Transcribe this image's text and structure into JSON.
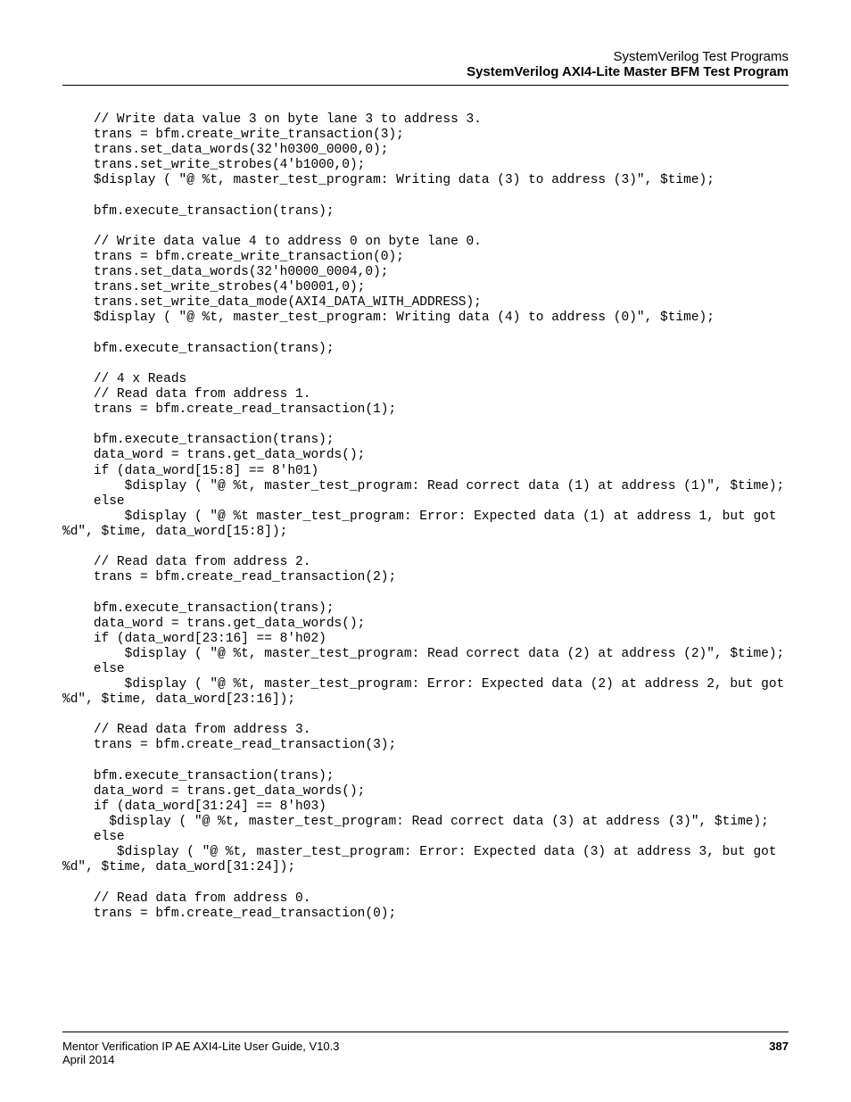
{
  "header": {
    "line1": "SystemVerilog Test Programs",
    "line2": "SystemVerilog AXI4-Lite Master BFM Test Program"
  },
  "code": "    // Write data value 3 on byte lane 3 to address 3.\n    trans = bfm.create_write_transaction(3);\n    trans.set_data_words(32'h0300_0000,0);\n    trans.set_write_strobes(4'b1000,0);\n    $display ( \"@ %t, master_test_program: Writing data (3) to address (3)\", $time);\n\n    bfm.execute_transaction(trans);\n\n    // Write data value 4 to address 0 on byte lane 0.\n    trans = bfm.create_write_transaction(0);\n    trans.set_data_words(32'h0000_0004,0);\n    trans.set_write_strobes(4'b0001,0);\n    trans.set_write_data_mode(AXI4_DATA_WITH_ADDRESS);\n    $display ( \"@ %t, master_test_program: Writing data (4) to address (0)\", $time);\n\n    bfm.execute_transaction(trans);\n\n    // 4 x Reads\n    // Read data from address 1.\n    trans = bfm.create_read_transaction(1);\n\n    bfm.execute_transaction(trans);\n    data_word = trans.get_data_words();\n    if (data_word[15:8] == 8'h01)\n        $display ( \"@ %t, master_test_program: Read correct data (1) at address (1)\", $time);\n    else\n        $display ( \"@ %t master_test_program: Error: Expected data (1) at address 1, but got %d\", $time, data_word[15:8]);\n\n    // Read data from address 2.\n    trans = bfm.create_read_transaction(2);\n\n    bfm.execute_transaction(trans);\n    data_word = trans.get_data_words();\n    if (data_word[23:16] == 8'h02)\n        $display ( \"@ %t, master_test_program: Read correct data (2) at address (2)\", $time);\n    else\n        $display ( \"@ %t, master_test_program: Error: Expected data (2) at address 2, but got %d\", $time, data_word[23:16]);\n\n    // Read data from address 3.\n    trans = bfm.create_read_transaction(3);\n\n    bfm.execute_transaction(trans);\n    data_word = trans.get_data_words();\n    if (data_word[31:24] == 8'h03)\n      $display ( \"@ %t, master_test_program: Read correct data (3) at address (3)\", $time);\n    else\n       $display ( \"@ %t, master_test_program: Error: Expected data (3) at address 3, but got %d\", $time, data_word[31:24]);\n\n    // Read data from address 0.\n    trans = bfm.create_read_transaction(0);",
  "footer": {
    "title": "Mentor Verification IP AE AXI4-Lite User Guide, V10.3",
    "page": "387",
    "date": "April 2014"
  }
}
